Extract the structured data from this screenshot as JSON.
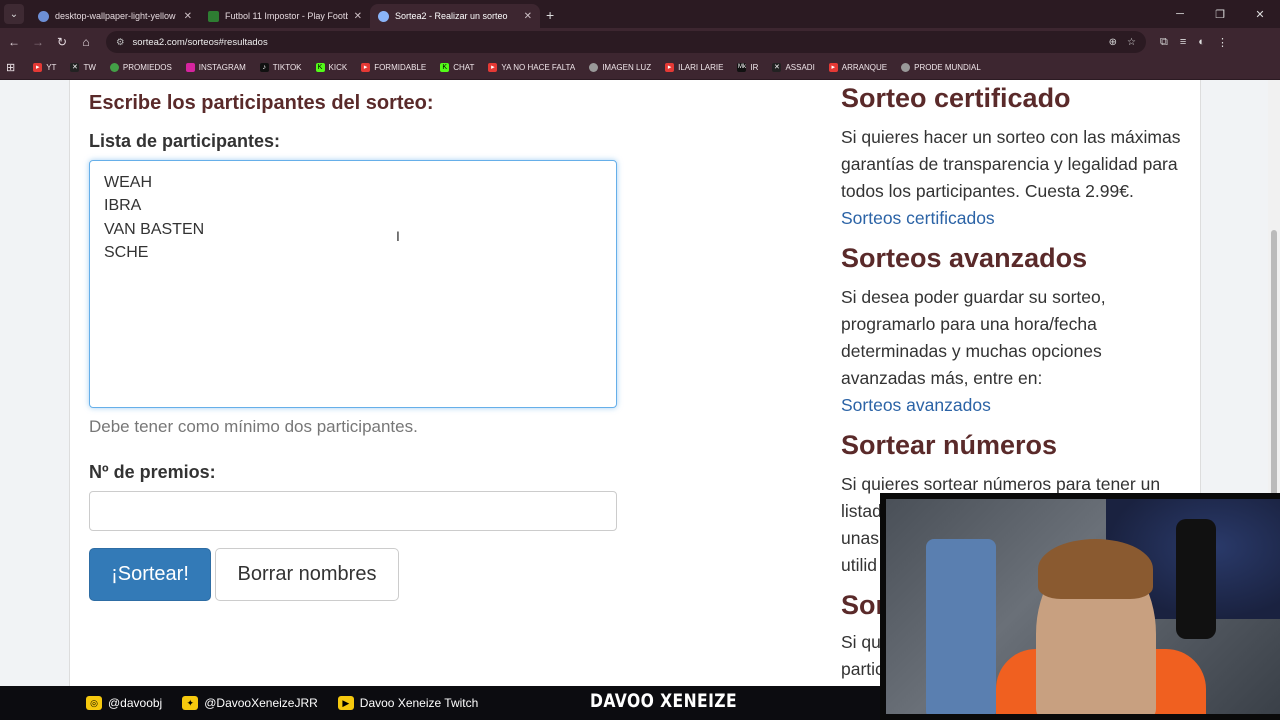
{
  "browser": {
    "tabs": [
      {
        "title": "desktop-wallpaper-light-yellow",
        "icon": "globe-icon",
        "color": "#6d8fd6"
      },
      {
        "title": "Futbol 11 Impostor - Play Footb",
        "icon": "football-icon",
        "color": "#2e7d32"
      },
      {
        "title": "Sortea2 - Realizar un sorteo",
        "icon": "sortea2-icon",
        "color": "#8ab4f8",
        "active": true
      }
    ],
    "url": "sortea2.com/sorteos#resultados",
    "bookmarks": [
      {
        "label": "YT",
        "color": "#e53935"
      },
      {
        "label": "TW",
        "color": "#222222"
      },
      {
        "label": "PROMIEDOS",
        "color": "#43a047"
      },
      {
        "label": "INSTAGRAM",
        "color": "#d6249f"
      },
      {
        "label": "TIKTOK",
        "color": "#111111"
      },
      {
        "label": "KICK",
        "color": "#53fc18"
      },
      {
        "label": "FORMIDABLE",
        "color": "#e53935"
      },
      {
        "label": "CHAT",
        "color": "#53fc18"
      },
      {
        "label": "YA NO HACE FALTA",
        "color": "#e53935"
      },
      {
        "label": "IMAGEN LUZ",
        "color": "#999999"
      },
      {
        "label": "ILARI LARIE",
        "color": "#e53935"
      },
      {
        "label": "IR",
        "color": "#111111"
      },
      {
        "label": "ASSADI",
        "color": "#222222"
      },
      {
        "label": "ARRANQUE",
        "color": "#e53935"
      },
      {
        "label": "PRODE MUNDIAL",
        "color": "#999999"
      }
    ]
  },
  "form": {
    "heading": "Escribe los participantes del sorteo:",
    "list_label": "Lista de participantes:",
    "participants": "WEAH\nIBRA\nVAN BASTEN\nSCHE",
    "help_text": "Debe tener como mínimo dos participantes.",
    "prizes_label": "Nº de premios:",
    "prizes_value": "",
    "draw_button": "¡Sortear!",
    "clear_button": "Borrar nombres"
  },
  "sidebar": {
    "cert_title": "Sorteo certificado",
    "cert_text": "Si quieres hacer un sorteo con las máximas garantías de transparencia y legalidad para todos los participantes. Cuesta 2.99€.",
    "cert_link": "Sorteos certificados",
    "adv_title": "Sorteos avanzados",
    "adv_text": "Si desea poder guardar su sorteo, programarlo para una hora/fecha determinadas y muchas opciones avanzadas más, entre en:",
    "adv_link": "Sorteos avanzados",
    "num_title": "Sortear números",
    "num_text_partial": "Si quieres sortear números para tener un",
    "num_line2": "listad",
    "num_line3": "unas",
    "num_line4": "utilid",
    "next_title_partial": "Sor",
    "next_line1": "Si qu",
    "next_line2": "partic"
  },
  "stream": {
    "instagram": "@davoobj",
    "twitter": "@DavooXeneizeJRR",
    "twitch": "Davoo Xeneize Twitch",
    "brand": "DAVOO XENEIZE"
  }
}
